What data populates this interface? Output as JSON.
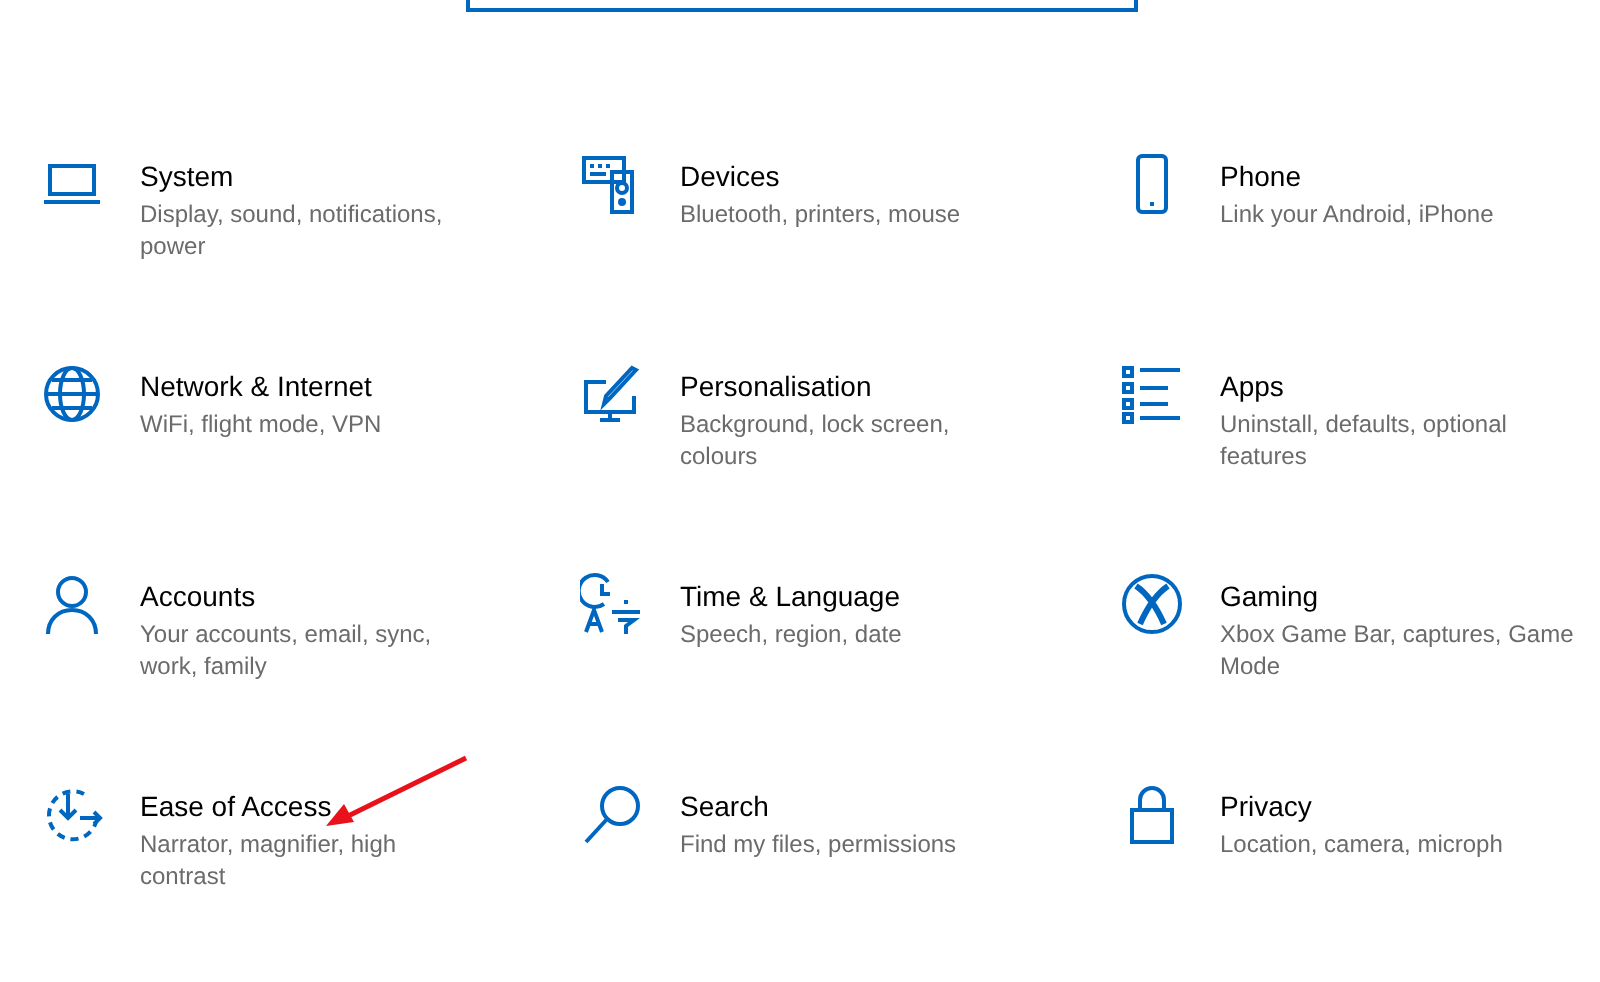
{
  "search_box": {
    "kind": "field"
  },
  "tiles": [
    {
      "title": "System",
      "description": "Display, sound, notifications, power",
      "pointer": false
    },
    {
      "title": "Devices",
      "description": "Bluetooth, printers, mouse",
      "pointer": false
    },
    {
      "title": "Phone",
      "description": "Link your Android, iPhone",
      "pointer": false
    },
    {
      "title": "Network & Internet",
      "description": "WiFi, flight mode, VPN",
      "pointer": false
    },
    {
      "title": "Personalisation",
      "description": "Background, lock screen, colours",
      "pointer": false
    },
    {
      "title": "Apps",
      "description": "Uninstall, defaults, optional features",
      "pointer": false
    },
    {
      "title": "Accounts",
      "description": "Your accounts, email, sync, work, family",
      "pointer": false
    },
    {
      "title": "Time & Language",
      "description": "Speech, region, date",
      "pointer": false
    },
    {
      "title": "Gaming",
      "description": "Xbox Game Bar, captures, Game Mode",
      "pointer": false
    },
    {
      "title": "Ease of Access",
      "description": "Narrator, magnifier, high contrast",
      "pointer": true
    },
    {
      "title": "Search",
      "description": "Find my files, permissions",
      "pointer": false
    },
    {
      "title": "Privacy",
      "description": "Location, camera, microph",
      "pointer": false
    }
  ]
}
